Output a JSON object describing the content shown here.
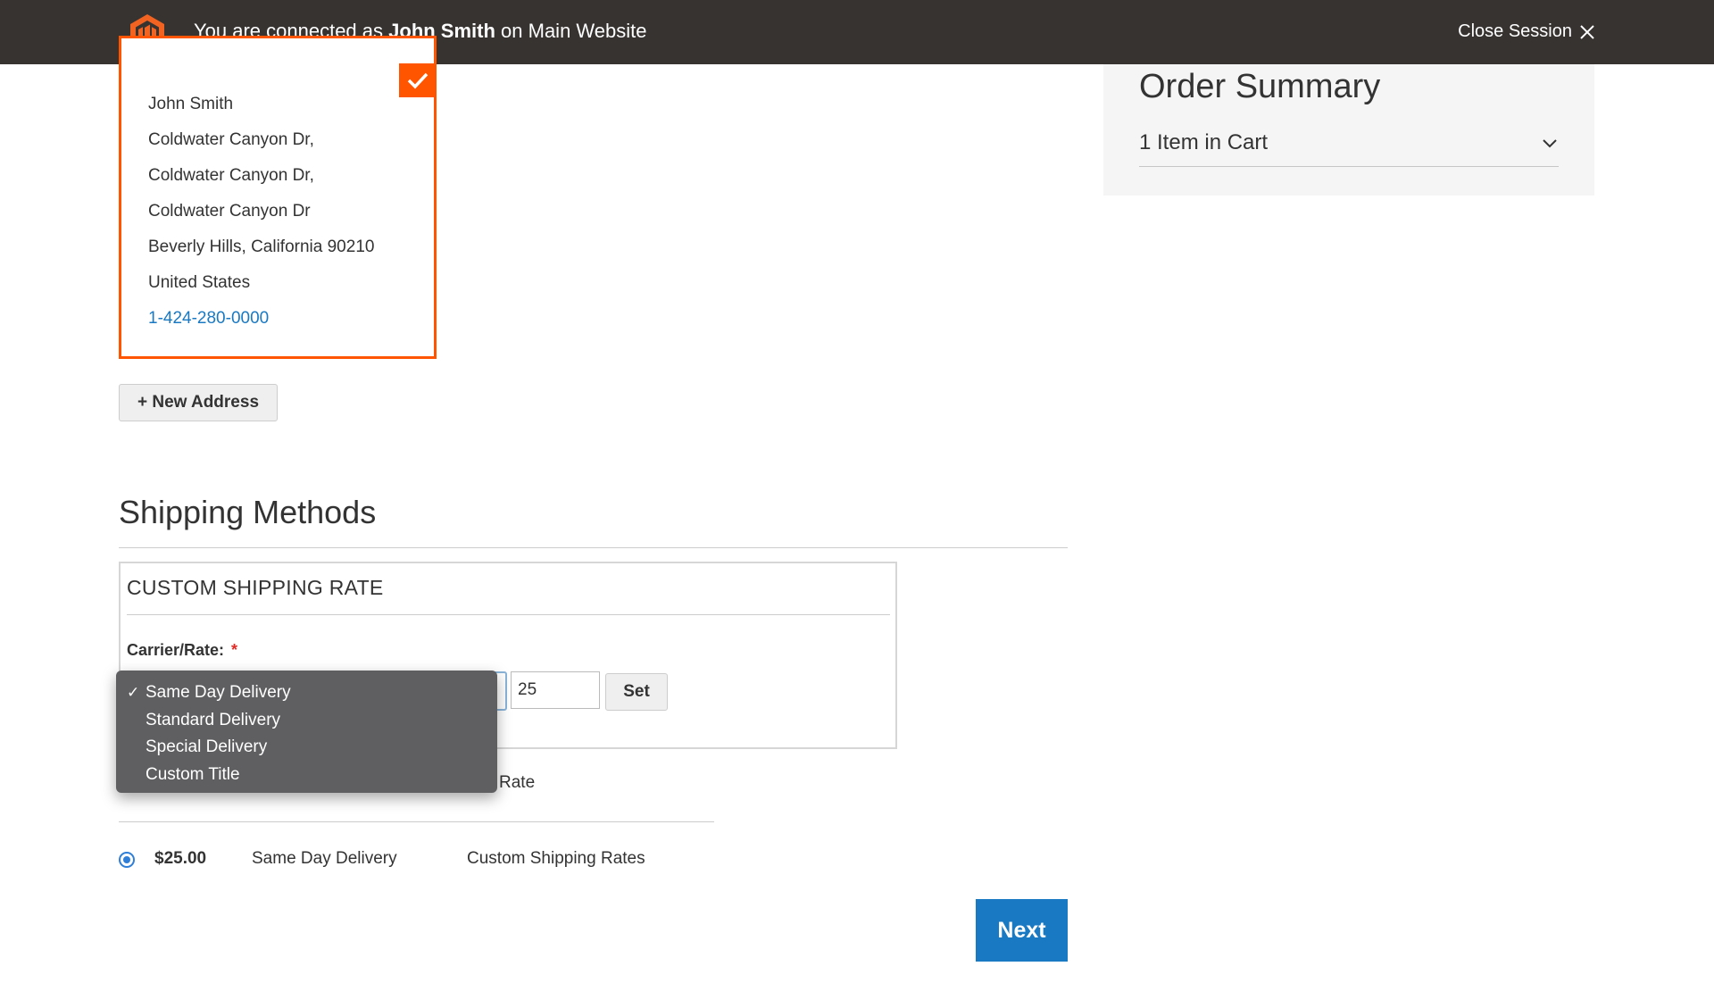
{
  "topbar": {
    "message_prefix": "You are connected as ",
    "user_name": "John Smith",
    "message_suffix": " on Main Website",
    "close_label": "Close Session"
  },
  "address": {
    "lines": [
      "John Smith",
      "Coldwater Canyon Dr,",
      "Coldwater Canyon Dr,",
      "Coldwater Canyon Dr",
      "Beverly Hills, California 90210",
      "United States"
    ],
    "phone": "1-424-280-0000"
  },
  "new_address_label": "+ New Address",
  "order_summary": {
    "title": "Order Summary",
    "cart_label": "1 Item in Cart"
  },
  "shipping": {
    "title": "Shipping Methods",
    "custom_rate": {
      "heading": "CUSTOM SHIPPING RATE",
      "label": "Carrier/Rate:",
      "required_mark": "*",
      "rate_value": "25",
      "set_label": "Set"
    },
    "dropdown": {
      "check_mark": "✓",
      "options": [
        "Same Day Delivery",
        "Standard Delivery",
        "Special Delivery",
        "Custom Title"
      ],
      "selected": "Same Day Delivery"
    },
    "column_header_visible_fragment": "Rate",
    "methods": [
      {
        "price": "$25.00",
        "name": "Same Day Delivery",
        "carrier": "Custom Shipping Rates",
        "selected": true
      }
    ]
  },
  "next_label": "Next",
  "colors": {
    "topbar": "#373330",
    "accent_orange": "#ff5501",
    "primary_blue": "#1979c3",
    "link_blue": "#1979c3",
    "dropdown_bg": "#5f5f62"
  },
  "icons": {
    "logo": "magento-logo",
    "close": "close-icon",
    "selected_check": "checkmark-icon",
    "cart_toggle": "chevron-down-icon"
  }
}
